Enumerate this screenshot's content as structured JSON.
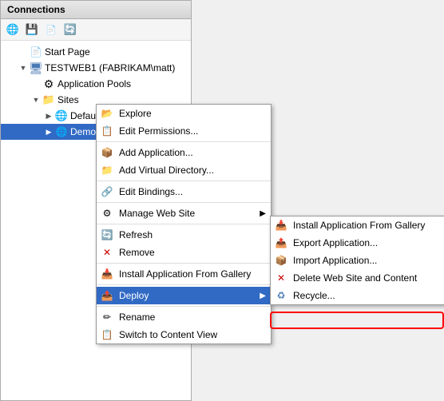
{
  "connections": {
    "title": "Connections",
    "toolbar": {
      "back_label": "◀",
      "forward_label": "▶",
      "save_label": "💾",
      "refresh_label": "🔄"
    },
    "tree": {
      "start_page": "Start Page",
      "server": "TESTWEB1 (FABRIKAM\\matt)",
      "app_pools": "Application Pools",
      "sites": "Sites",
      "default_web_site": "Default Web Site",
      "demo_site": "DemoSite"
    }
  },
  "context_menu": {
    "items": [
      {
        "id": "explore",
        "label": "Explore",
        "icon": "folder-open"
      },
      {
        "id": "edit-permissions",
        "label": "Edit Permissions...",
        "icon": "shield"
      },
      {
        "id": "sep1",
        "type": "separator"
      },
      {
        "id": "add-application",
        "label": "Add Application...",
        "icon": "plus-app"
      },
      {
        "id": "add-virtual-directory",
        "label": "Add Virtual Directory...",
        "icon": "plus-folder"
      },
      {
        "id": "sep2",
        "type": "separator"
      },
      {
        "id": "edit-bindings",
        "label": "Edit Bindings...",
        "icon": "bindings"
      },
      {
        "id": "sep3",
        "type": "separator"
      },
      {
        "id": "manage-web-site",
        "label": "Manage Web Site",
        "icon": "manage",
        "hasArrow": true
      },
      {
        "id": "sep4",
        "type": "separator"
      },
      {
        "id": "refresh",
        "label": "Refresh",
        "icon": "refresh"
      },
      {
        "id": "remove",
        "label": "Remove",
        "icon": "remove"
      },
      {
        "id": "sep5",
        "type": "separator"
      },
      {
        "id": "install-gallery",
        "label": "Install Application From Gallery",
        "icon": "install"
      },
      {
        "id": "sep6",
        "type": "separator"
      },
      {
        "id": "deploy",
        "label": "Deploy",
        "icon": "deploy",
        "hasArrow": true,
        "highlighted": true
      },
      {
        "id": "sep7",
        "type": "separator"
      },
      {
        "id": "rename",
        "label": "Rename",
        "icon": "rename"
      },
      {
        "id": "switch-content",
        "label": "Switch to Content View",
        "icon": "switch"
      }
    ]
  },
  "deploy_submenu": {
    "items": [
      {
        "id": "install-gallery2",
        "label": "Install Application From Gallery",
        "icon": "install"
      },
      {
        "id": "export-app",
        "label": "Export Application...",
        "icon": "export"
      },
      {
        "id": "import-app",
        "label": "Import Application...",
        "icon": "import",
        "highlighted": true
      },
      {
        "id": "delete-web-site",
        "label": "Delete Web Site and Content",
        "icon": "delete"
      },
      {
        "id": "recycle",
        "label": "Recycle...",
        "icon": "recycle"
      }
    ]
  }
}
